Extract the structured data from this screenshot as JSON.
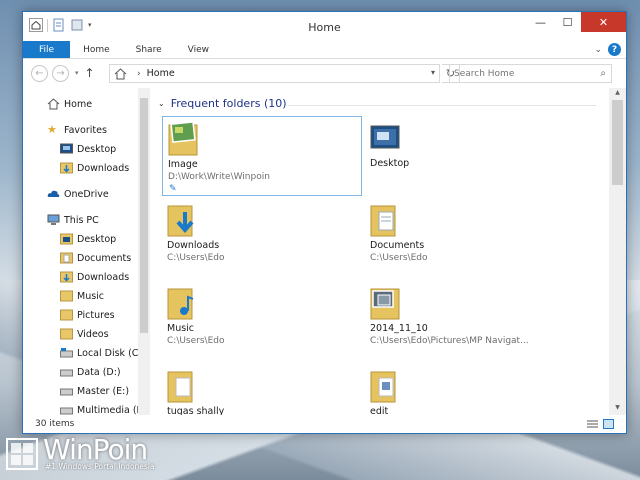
{
  "window": {
    "title": "Home"
  },
  "ribbon": {
    "tabs": [
      {
        "label": "File"
      },
      {
        "label": "Home"
      },
      {
        "label": "Share"
      },
      {
        "label": "View"
      }
    ]
  },
  "address": {
    "location": "Home"
  },
  "search": {
    "placeholder": "Search Home"
  },
  "nav": {
    "items": [
      {
        "label": "Home",
        "icon": "home-icon"
      },
      {
        "label": "Favorites",
        "icon": "star-icon"
      },
      {
        "label": "Desktop",
        "icon": "desktop-icon"
      },
      {
        "label": "Downloads",
        "icon": "downloads-icon"
      },
      {
        "label": "OneDrive",
        "icon": "cloud-icon"
      },
      {
        "label": "This PC",
        "icon": "computer-icon"
      },
      {
        "label": "Desktop",
        "icon": "desktop-icon"
      },
      {
        "label": "Documents",
        "icon": "folder-icon"
      },
      {
        "label": "Downloads",
        "icon": "downloads-icon"
      },
      {
        "label": "Music",
        "icon": "folder-icon"
      },
      {
        "label": "Pictures",
        "icon": "folder-icon"
      },
      {
        "label": "Videos",
        "icon": "folder-icon"
      },
      {
        "label": "Local Disk (C:)",
        "icon": "drive-icon"
      },
      {
        "label": "Data (D:)",
        "icon": "drive-icon"
      },
      {
        "label": "Master (E:)",
        "icon": "drive-icon"
      },
      {
        "label": "Multimedia (F",
        "icon": "drive-icon"
      }
    ]
  },
  "main": {
    "group_title": "Frequent folders (10)",
    "folders": [
      {
        "name": "Image",
        "path": "D:\\Work\\Write\\Winpoin",
        "icon": "image-folder-icon"
      },
      {
        "name": "Desktop",
        "path": "",
        "icon": "desktop-icon"
      },
      {
        "name": "Downloads",
        "path": "C:\\Users\\Edo",
        "icon": "downloads-folder-icon"
      },
      {
        "name": "Documents",
        "path": "C:\\Users\\Edo",
        "icon": "documents-folder-icon"
      },
      {
        "name": "Music",
        "path": "C:\\Users\\Edo",
        "icon": "music-folder-icon"
      },
      {
        "name": "2014_11_10",
        "path": "C:\\Users\\Edo\\Pictures\\MP Navigat...",
        "icon": "photo-folder-icon"
      },
      {
        "name": "tugas shally",
        "path": "",
        "icon": "folder-icon"
      },
      {
        "name": "edit",
        "path": "",
        "icon": "folder-icon"
      }
    ]
  },
  "status": {
    "item_count": "30 items"
  },
  "watermark": {
    "title": "WinPoin",
    "subtitle": "#1 Windows Portal Indonesia"
  },
  "colors": {
    "accent": "#1979ca",
    "close": "#c7382b",
    "group_title": "#1e3287"
  }
}
